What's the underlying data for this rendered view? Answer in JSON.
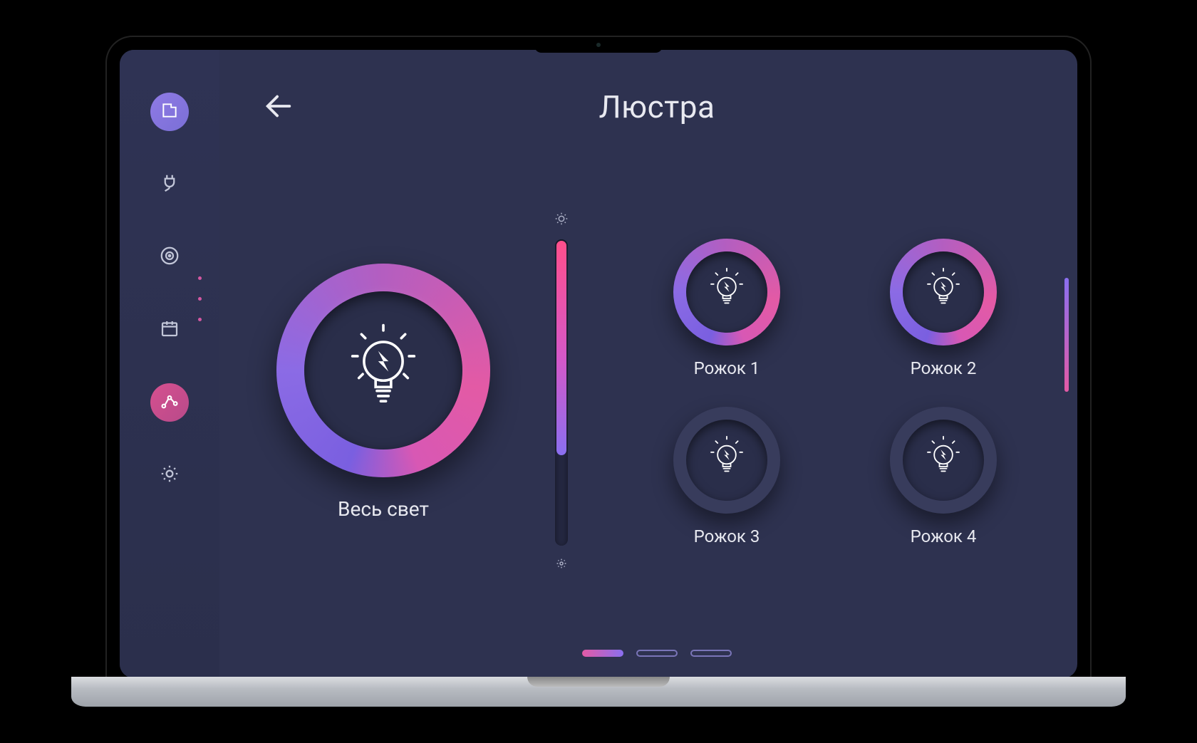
{
  "header": {
    "title": "Люстра",
    "back_icon": "arrow-left"
  },
  "sidebar": {
    "items": [
      {
        "name": "home-icon",
        "active": "purple"
      },
      {
        "name": "plug-icon",
        "active": null
      },
      {
        "name": "disc-icon",
        "active": null
      },
      {
        "name": "calendar-icon",
        "active": null
      },
      {
        "name": "graph-icon",
        "active": "pink"
      },
      {
        "name": "gear-icon",
        "active": null
      }
    ]
  },
  "main_light": {
    "label": "Весь свет",
    "on": true
  },
  "slider": {
    "max_icon": "brightness-high",
    "min_icon": "brightness-low",
    "value_percent": 70
  },
  "bulbs": [
    {
      "label": "Рожок 1",
      "on": true
    },
    {
      "label": "Рожок 2",
      "on": true
    },
    {
      "label": "Рожок 3",
      "on": false
    },
    {
      "label": "Рожок 4",
      "on": false
    }
  ],
  "pager": {
    "count": 3,
    "active_index": 0
  },
  "colors": {
    "accent_purple": "#8a6ff0",
    "accent_pink": "#e35aa5",
    "bg": "#2e3250"
  }
}
